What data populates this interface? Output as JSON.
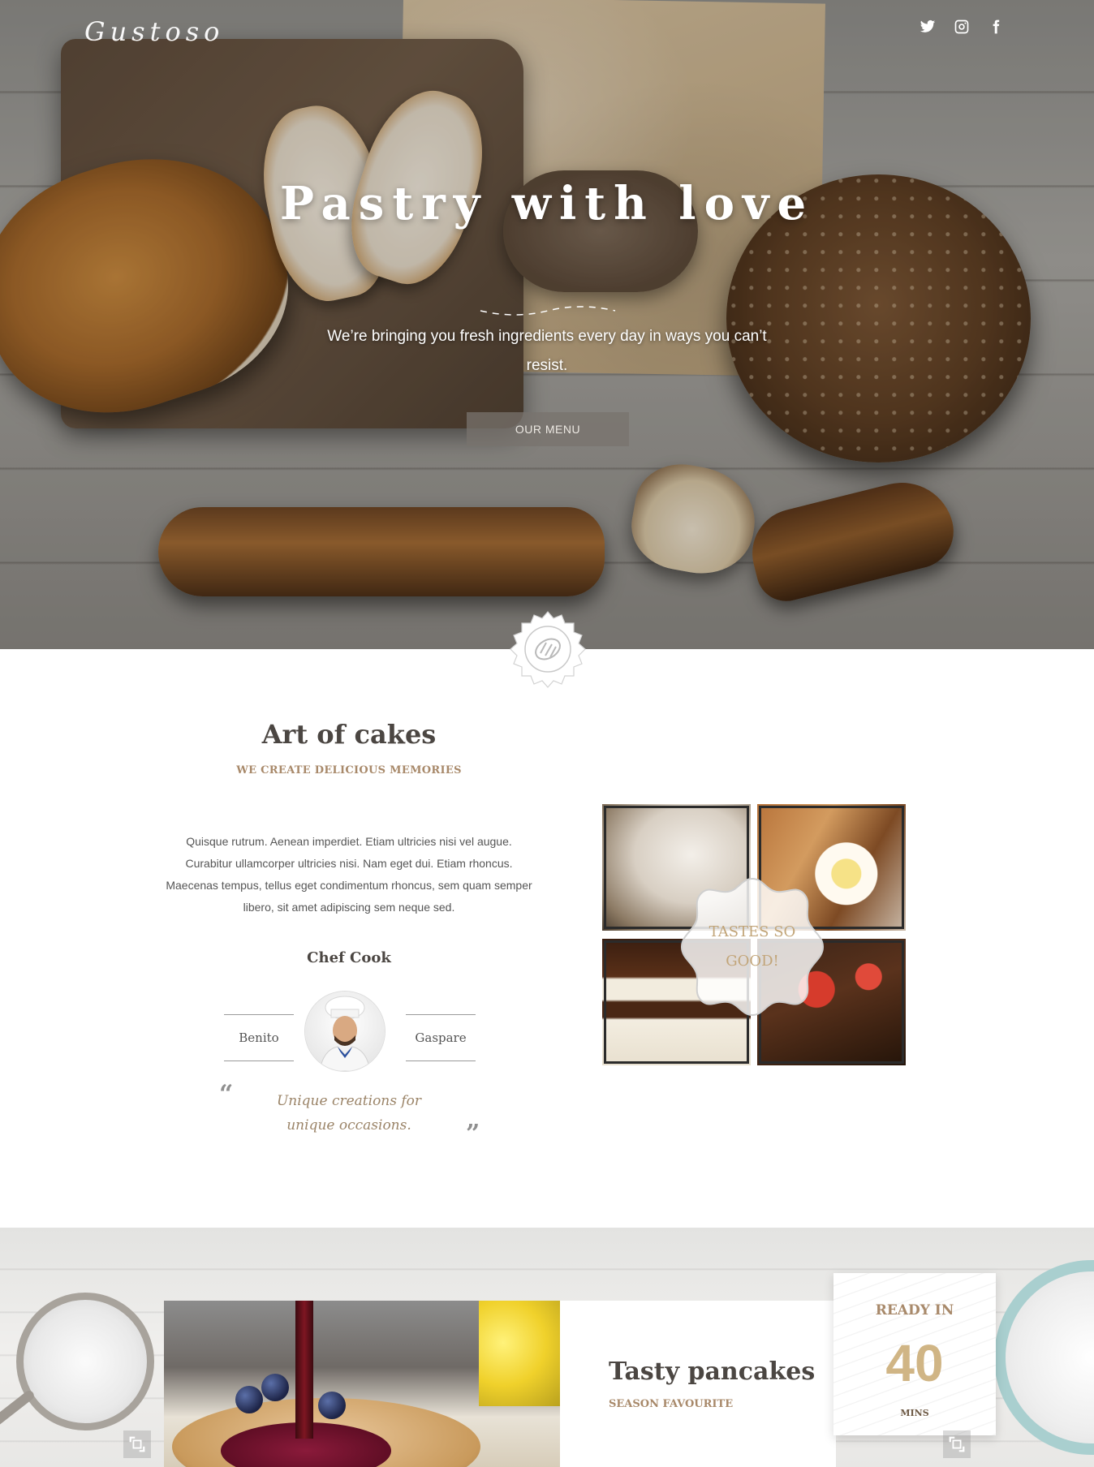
{
  "header": {
    "logo": "Gustoso",
    "socials": [
      {
        "name": "twitter",
        "icon": "twitter-icon"
      },
      {
        "name": "instagram",
        "icon": "instagram-icon"
      },
      {
        "name": "facebook",
        "icon": "facebook-icon"
      }
    ]
  },
  "hero": {
    "title": "Pastry with love",
    "subtitle": "We’re bringing you fresh ingredients every day in ways you can’t resist.",
    "button_label": "OUR MENU"
  },
  "about": {
    "title": "Art of cakes",
    "subtitle": "WE CREATE DELICIOUS MEMORIES",
    "body": "Quisque rutrum. Aenean imperdiet. Etiam ultricies nisi vel augue. Curabitur ullamcorper ultricies nisi. Nam eget dui. Etiam rhoncus. Maecenas tempus, tellus eget condimentum rhoncus, sem quam semper libero, sit amet adipiscing sem neque sed.",
    "chef_heading": "Chef Cook",
    "chef_first_name": "Benito",
    "chef_last_name": "Gaspare",
    "quote": "Unique creations for unique occasions."
  },
  "collage": {
    "badge_text": "TASTES SO GOOD!"
  },
  "feature": {
    "title": "Tasty pancakes",
    "subtitle": "SEASON FAVOURITE",
    "ready_label": "READY IN",
    "ready_value": "40",
    "ready_unit": "MINS"
  },
  "colors": {
    "accent": "#a8896a",
    "heading": "#4b4642",
    "ready_number": "#d0b585"
  }
}
